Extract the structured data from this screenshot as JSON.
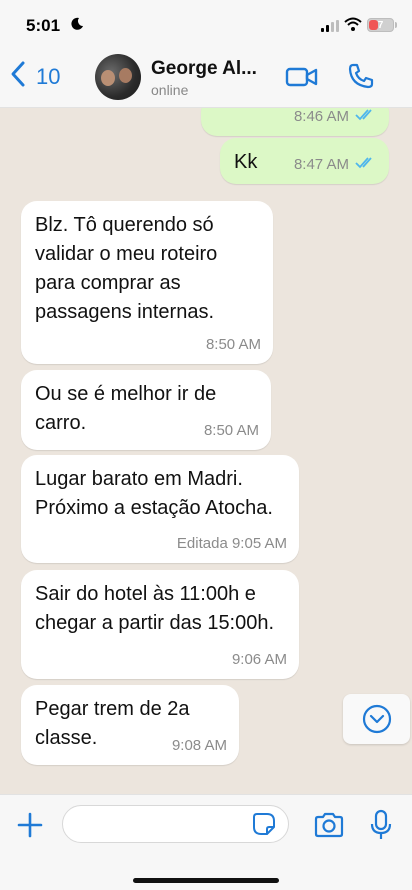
{
  "status_bar": {
    "time": "5:01",
    "battery": "7"
  },
  "header": {
    "back_count": "10",
    "contact_name": "George Al...",
    "contact_status": "online"
  },
  "messages": [
    {
      "direction": "out",
      "text": "",
      "time": "8:46 AM",
      "read": true
    },
    {
      "direction": "out",
      "text": "Kk",
      "time": "8:47 AM",
      "read": true
    },
    {
      "direction": "in",
      "text": "Blz. Tô querendo só validar o meu roteiro para comprar as passagens internas.",
      "time": "8:50 AM"
    },
    {
      "direction": "in",
      "text": "Ou se é melhor ir de carro.",
      "time": "8:50 AM"
    },
    {
      "direction": "in",
      "text": "Lugar barato em Madri. Próximo a estação Atocha.",
      "time": "Editada 9:05 AM"
    },
    {
      "direction": "in",
      "text": "Sair do hotel às 11:00h e chegar a partir das 15:00h.",
      "time": "9:06 AM"
    },
    {
      "direction": "in",
      "text": "Pegar trem de 2a classe.",
      "time": "9:08 AM"
    }
  ],
  "composer": {
    "placeholder": ""
  },
  "colors": {
    "accent": "#1f7ad6",
    "outgoing_bubble": "#dcf8c6",
    "incoming_bubble": "#ffffff",
    "chat_background": "#ece5dd",
    "read_ticks": "#4fb6ec"
  }
}
